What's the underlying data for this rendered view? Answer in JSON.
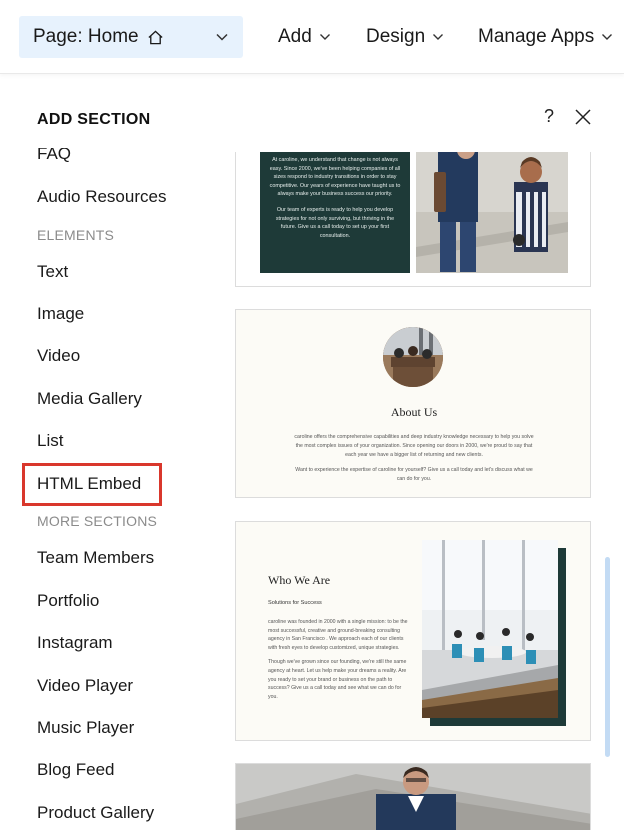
{
  "topbar": {
    "page_label": "Page: Home",
    "menus": [
      "Add",
      "Design",
      "Manage Apps"
    ]
  },
  "panel": {
    "title": "ADD SECTION",
    "help": "?"
  },
  "list": {
    "items_top": [
      "FAQ",
      "Audio Resources"
    ],
    "elements_heading": "ELEMENTS",
    "elements": [
      "Text",
      "Image",
      "Video",
      "Media Gallery",
      "List",
      "HTML Embed"
    ],
    "more_heading": "MORE SECTIONS",
    "more": [
      "Team Members",
      "Portfolio",
      "Instagram",
      "Video Player",
      "Music Player",
      "Blog Feed",
      "Product Gallery"
    ]
  },
  "preview1": {
    "para1": "At caroline, we understand that change is not always easy. Since 2000, we've been helping companies of all sizes respond to industry transitions in order to stay competitive. Our years of experience have taught us to always make your business success our priority.",
    "para2": "Our team of experts is ready to help you develop strategies for not only surviving, but thriving in the future. Give us a call today to set up your first consultation."
  },
  "preview2": {
    "title": "About Us",
    "para1": "caroline offers the comprehensive capabilities and deep industry knowledge necessary to help you solve the most complex issues of your organization. Since opening our doors in 2000, we're proud to say that each year we have a bigger list of returning and new clients.",
    "para2": "Want to experience the expertise of caroline for yourself? Give us a call today and let's discuss what we can do for you."
  },
  "preview3": {
    "title": "Who We Are",
    "subtitle": "Solutions for Success",
    "para1": "caroline was founded in 2000 with a single mission: to be the most successful, creative and ground-breaking consulting agency in San Francisco . We approach each of our clients with fresh eyes to develop customized, unique strategies.",
    "para2": "Though we've grown since our founding, we're still the same agency at heart. Let us help make your dreams a reality. Are you ready to set your brand or business on the path to success? Give us a call today and see what we can do for you."
  },
  "colors": {
    "accent_bg": "#e7f2fd",
    "highlight": "#d9372c",
    "dark_card": "#1e3a38",
    "scroll_thumb": "#c3dbf4"
  }
}
